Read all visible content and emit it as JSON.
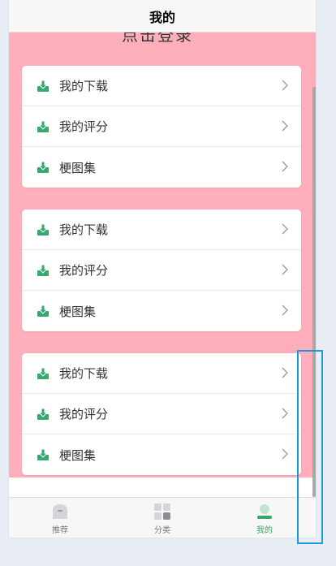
{
  "header": {
    "title": "我的"
  },
  "profile": {
    "login_text": "点击登录"
  },
  "cards": [
    {
      "items": [
        {
          "label": "我的下载"
        },
        {
          "label": "我的评分"
        },
        {
          "label": "梗图集"
        }
      ]
    },
    {
      "items": [
        {
          "label": "我的下载"
        },
        {
          "label": "我的评分"
        },
        {
          "label": "梗图集"
        }
      ]
    },
    {
      "items": [
        {
          "label": "我的下载"
        },
        {
          "label": "我的评分"
        },
        {
          "label": "梗图集"
        }
      ]
    }
  ],
  "tabbar": {
    "tabs": [
      {
        "label": "推荐",
        "icon": "home-icon",
        "active": false
      },
      {
        "label": "分类",
        "icon": "category-icon",
        "active": false
      },
      {
        "label": "我的",
        "icon": "user-icon",
        "active": true
      }
    ]
  },
  "colors": {
    "pink_background": "#ffafbb",
    "accent_green": "#35a86e",
    "focus_outline": "#1d9bdc"
  }
}
